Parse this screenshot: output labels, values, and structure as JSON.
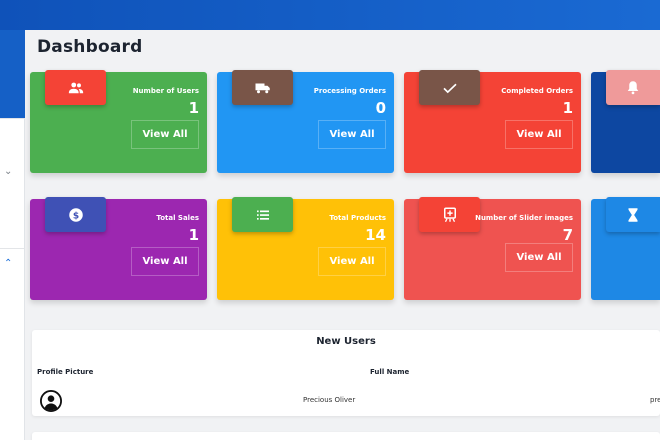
{
  "page": {
    "title": "Dashboard"
  },
  "cards": [
    {
      "title": "Number of Users",
      "count": "1",
      "button": "View All",
      "color": "#4caf50",
      "icon_color": "#f44336",
      "icon": "users-icon"
    },
    {
      "title": "Processing Orders",
      "count": "0",
      "button": "View All",
      "color": "#2196f3",
      "icon_color": "#795548",
      "icon": "truck-icon"
    },
    {
      "title": "Completed Orders",
      "count": "1",
      "button": "View All",
      "color": "#f44336",
      "icon_color": "#795548",
      "icon": "checkmark-icon"
    },
    {
      "title": "",
      "count": "",
      "button": "",
      "color": "#0d47a1",
      "icon_color": "#ef9a9a",
      "icon": "bell-icon"
    },
    {
      "title": "Total Sales",
      "count": "1",
      "button": "View All",
      "color": "#9c27b0",
      "icon_color": "#3f51b5",
      "icon": "dollar-icon"
    },
    {
      "title": "Total Products",
      "count": "14",
      "button": "View All",
      "color": "#ffc107",
      "icon_color": "#4caf50",
      "icon": "list-icon"
    },
    {
      "title": "Number of Slider images",
      "count": "7",
      "button": "View All",
      "color": "#ef5350",
      "icon_color": "#f44336",
      "icon": "slider-image-icon"
    },
    {
      "title": "",
      "count": "",
      "button": "",
      "color": "#1e88e5",
      "icon_color": "#1e88e5",
      "icon": "hourglass-icon"
    }
  ],
  "new_users": {
    "title": "New Users",
    "columns": [
      "Profile Picture",
      "Full Name"
    ],
    "rows": [
      {
        "full_name": "Precious Oliver",
        "extra": "pre"
      }
    ]
  }
}
